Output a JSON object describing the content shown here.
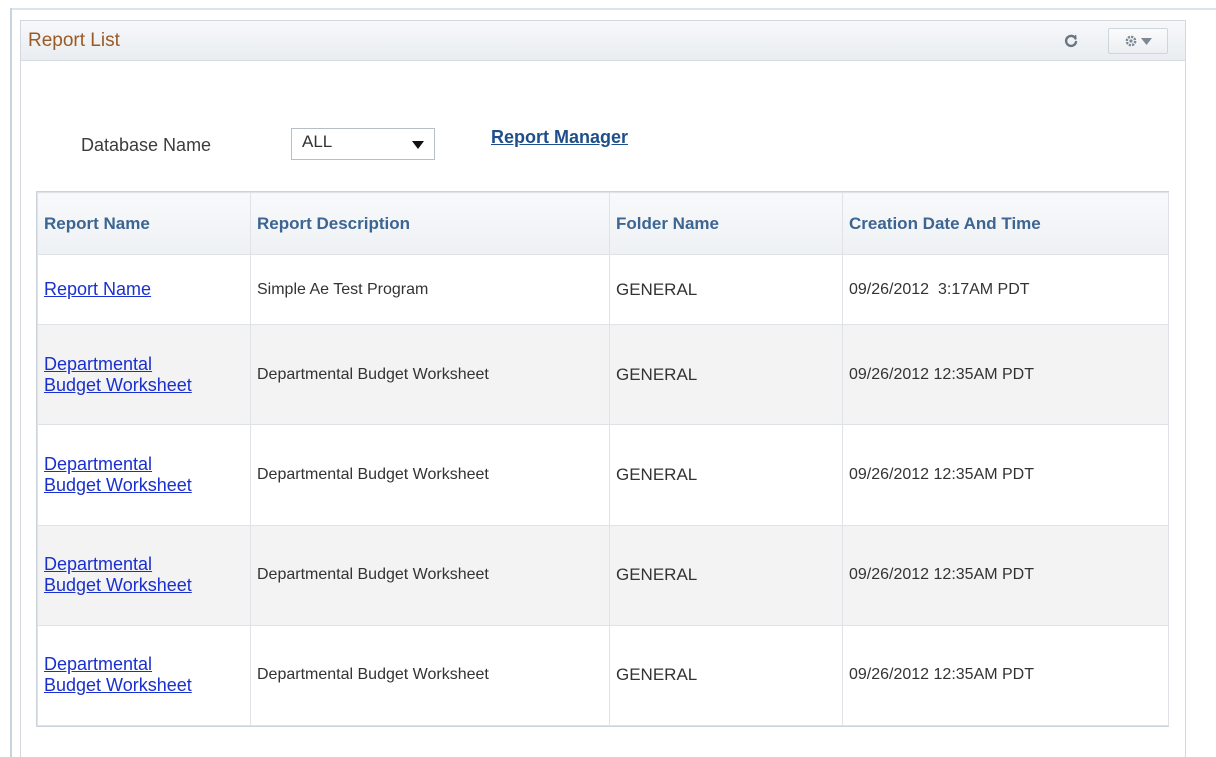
{
  "pagelet": {
    "title": "Report List"
  },
  "filter": {
    "label": "Database Name",
    "selected_value": "ALL"
  },
  "links": {
    "report_manager": "Report Manager"
  },
  "table": {
    "headers": [
      "Report Name",
      "Report Description",
      "Folder Name",
      "Creation Date And Time"
    ],
    "rows": [
      {
        "name_line1": "Report Name",
        "name_line2": "",
        "description": "Simple Ae Test Program",
        "folder": "GENERAL",
        "created": "09/26/2012  3:17AM PDT"
      },
      {
        "name_line1": "Departmental",
        "name_line2": "Budget Worksheet",
        "description": "Departmental Budget Worksheet",
        "folder": "GENERAL",
        "created": "09/26/2012 12:35AM PDT"
      },
      {
        "name_line1": "Departmental",
        "name_line2": "Budget Worksheet",
        "description": "Departmental Budget Worksheet",
        "folder": "GENERAL",
        "created": "09/26/2012 12:35AM PDT"
      },
      {
        "name_line1": "Departmental",
        "name_line2": "Budget Worksheet",
        "description": "Departmental Budget Worksheet",
        "folder": "GENERAL",
        "created": "09/26/2012 12:35AM PDT"
      },
      {
        "name_line1": "Departmental",
        "name_line2": "Budget Worksheet",
        "description": "Departmental Budget Worksheet",
        "folder": "GENERAL",
        "created": "09/26/2012 12:35AM PDT"
      }
    ]
  },
  "icons": {
    "refresh": "refresh-icon",
    "settings": "gear-icon",
    "dropdown": "chevron-down-icon"
  },
  "colors": {
    "title": "#9b5a25",
    "header_text": "#3d6592",
    "link": "#1a2fd0",
    "report_manager_link": "#1f4f8b",
    "alt_row": "#f3f3f3"
  }
}
